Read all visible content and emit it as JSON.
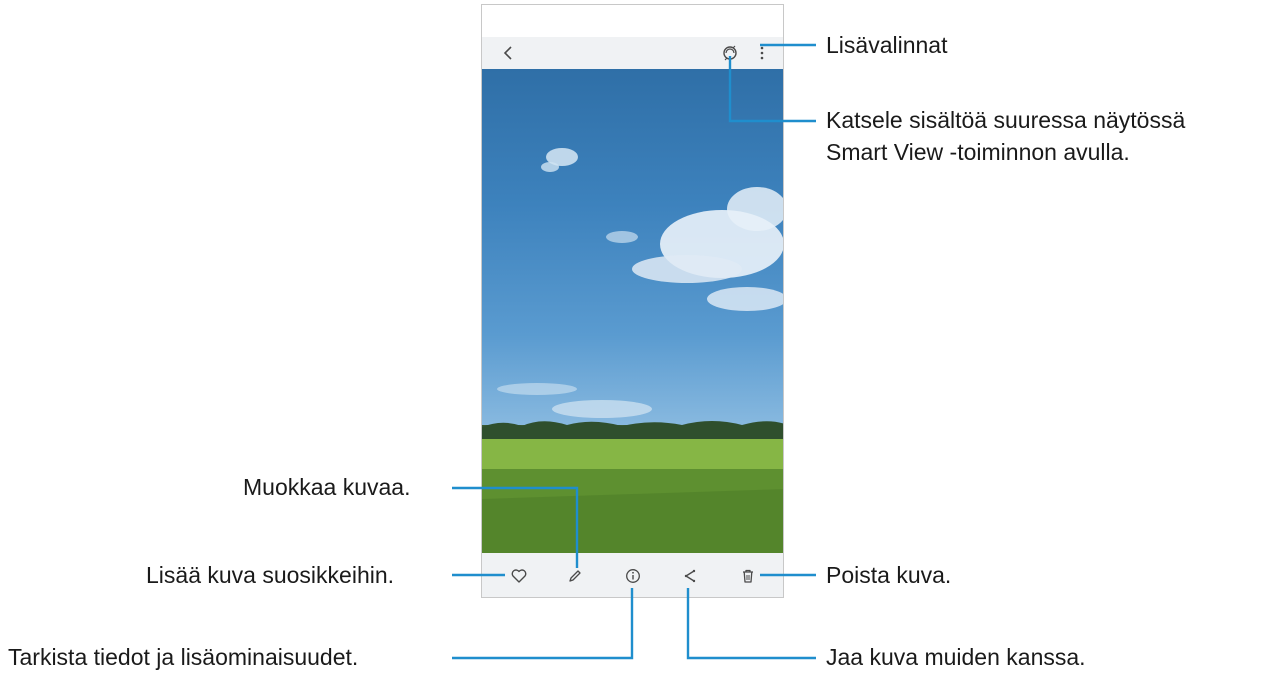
{
  "phone": {
    "toolbar_top": {
      "back": "back-icon",
      "smart_view": "smart-view-icon",
      "more": "more-options-icon"
    },
    "toolbar_bottom": [
      "favorite-heart-icon",
      "edit-pencil-icon",
      "info-icon",
      "share-icon",
      "delete-trash-icon"
    ]
  },
  "callouts": {
    "more_options": "Lisävalinnat",
    "smart_view_line1": "Katsele sisältöä suuressa näytössä",
    "smart_view_line2": "Smart View -toiminnon avulla.",
    "edit": "Muokkaa kuvaa.",
    "favorite": "Lisää kuva suosikkeihin.",
    "delete": "Poista kuva.",
    "details": "Tarkista tiedot ja lisäominaisuudet.",
    "share": "Jaa kuva muiden kanssa."
  },
  "colors": {
    "callout_line": "#1f8ecd",
    "toolbar_bg": "#f0f2f4",
    "icon": "#4a4a4a"
  }
}
